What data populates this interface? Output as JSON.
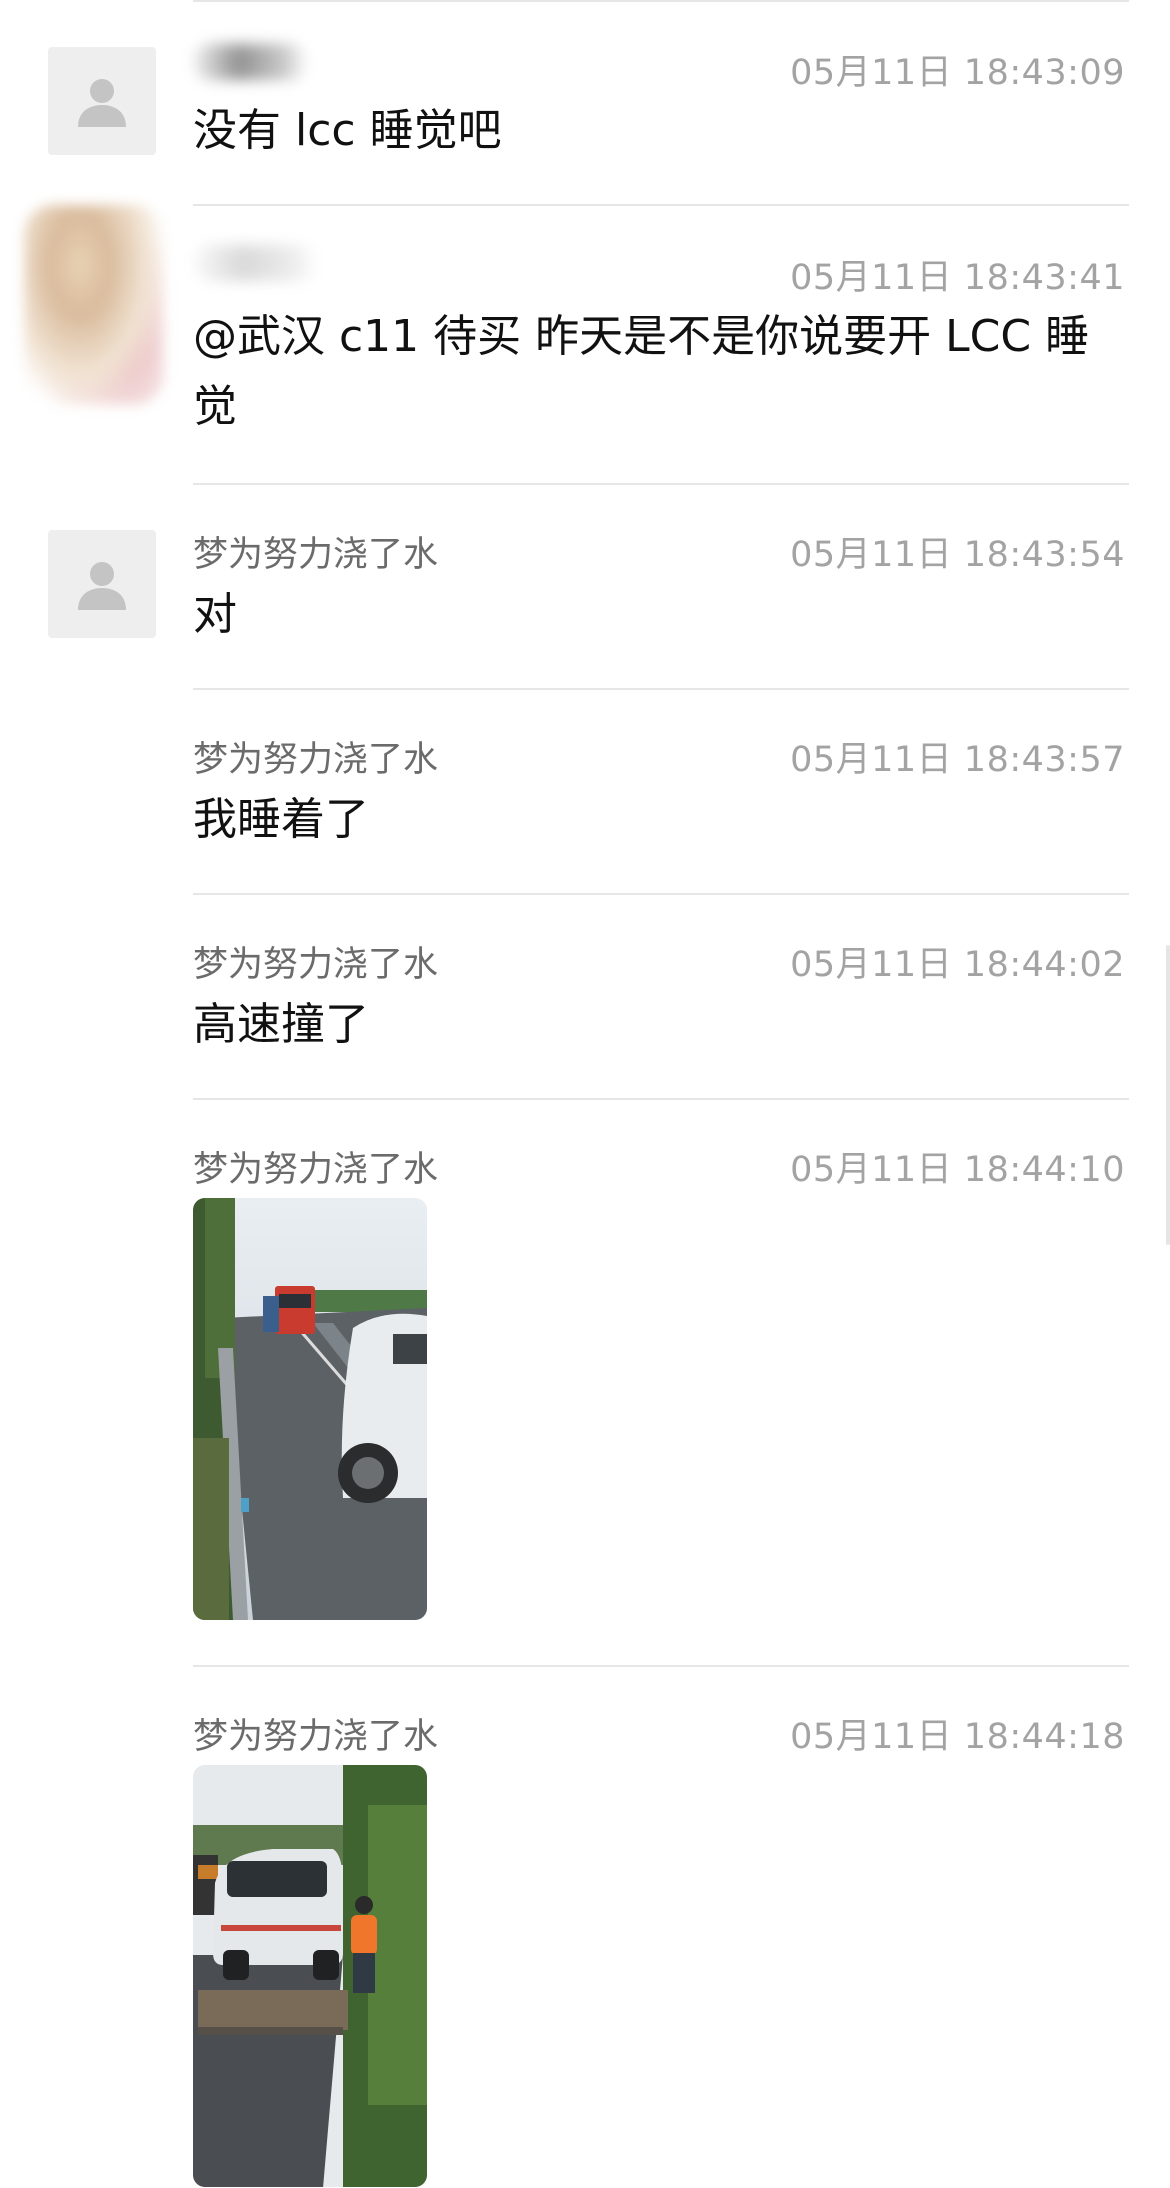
{
  "messages": [
    {
      "name": "",
      "time": "05月11日 18:43:09",
      "text": "没有 lcc 睡觉吧",
      "avatar": "default-user"
    },
    {
      "name": "",
      "time": "05月11日 18:43:41",
      "text": "@武汉 c11 待买 昨天是不是你说要开 LCC 睡觉",
      "avatar": "blurred-photo"
    },
    {
      "name": "梦为努力浇了水",
      "time": "05月11日 18:43:54",
      "text": "对",
      "avatar": "default-user"
    },
    {
      "name": "梦为努力浇了水",
      "time": "05月11日 18:43:57",
      "text": "我睡着了"
    },
    {
      "name": "梦为努力浇了水",
      "time": "05月11日 18:44:02",
      "text": "高速撞了"
    },
    {
      "name": "梦为努力浇了水",
      "time": "05月11日 18:44:10",
      "image": "highway-crash-photo"
    },
    {
      "name": "梦为努力浇了水",
      "time": "05月11日 18:44:18",
      "image": "tow-truck-photo"
    }
  ],
  "colors": {
    "name": "#6b6b6b",
    "time": "#a3a3a3",
    "text": "#111111",
    "separator": "#e6e6e6"
  }
}
